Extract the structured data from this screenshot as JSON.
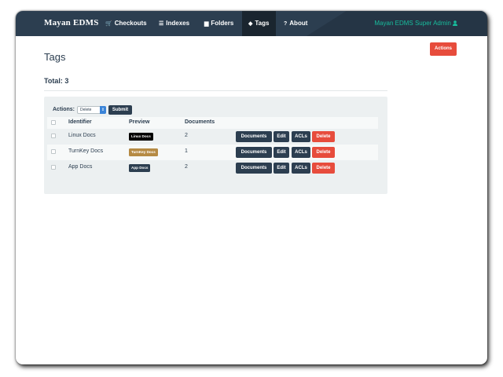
{
  "colors": {
    "navbar": "#2c3e50",
    "accent": "#18bc9c",
    "danger": "#e74c3c",
    "panel": "#ecf0f1"
  },
  "navbar": {
    "brand": "Mayan EDMS",
    "items": [
      {
        "label": "Checkouts",
        "icon": "shopping-cart-icon",
        "glyph": "🛒",
        "active": false
      },
      {
        "label": "Indexes",
        "icon": "list-icon",
        "glyph": "☰",
        "active": false
      },
      {
        "label": "Folders",
        "icon": "folder-icon",
        "glyph": "▆",
        "active": false
      },
      {
        "label": "Tags",
        "icon": "tag-icon",
        "glyph": "◆",
        "active": true
      },
      {
        "label": "About",
        "icon": "question-icon",
        "glyph": "?",
        "active": false
      }
    ],
    "user": {
      "label": "Mayan EDMS Super Admin",
      "icon": "user-icon"
    }
  },
  "actions_button": "Actions",
  "page": {
    "title": "Tags",
    "total": "Total: 3"
  },
  "bulk": {
    "label": "Actions:",
    "selected": "Delete",
    "submit": "Submit"
  },
  "table": {
    "headers": {
      "identifier": "Identifier",
      "preview": "Preview",
      "documents": "Documents"
    },
    "rows": [
      {
        "identifier": "Linux Docs",
        "preview": "Linux Docs",
        "color": "#000000",
        "documents": "2"
      },
      {
        "identifier": "TurnKey Docs",
        "preview": "TurnKey Docs",
        "color": "#b58a44",
        "documents": "1"
      },
      {
        "identifier": "App Docs",
        "preview": "App Docs",
        "color": "#2c3e50",
        "documents": "2"
      }
    ],
    "row_actions": {
      "documents": "Documents",
      "edit": "Edit",
      "acls": "ACLs",
      "delete": "Delete"
    }
  }
}
